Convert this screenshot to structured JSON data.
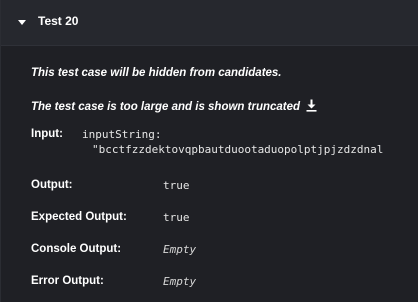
{
  "test_case": {
    "title": "Test 20",
    "hidden_note": "This test case will be hidden from candidates.",
    "truncated_note": "The test case is too large and is shown truncated",
    "input": {
      "label": "Input:",
      "param": "inputString:",
      "value": "\"bcctfzzdektovqpbautduootaduopolptjpjzdzdnal"
    },
    "output": {
      "label": "Output:",
      "value": "true"
    },
    "expected_output": {
      "label": "Expected Output:",
      "value": "true"
    },
    "console_output": {
      "label": "Console Output:",
      "value": "Empty"
    },
    "error_output": {
      "label": "Error Output:",
      "value": "Empty"
    }
  },
  "icons": {
    "collapse": "chevron-down-icon",
    "download": "download-icon"
  },
  "colors": {
    "background": "#1f2025",
    "header_background": "#26282e",
    "text": "#ffffff"
  }
}
